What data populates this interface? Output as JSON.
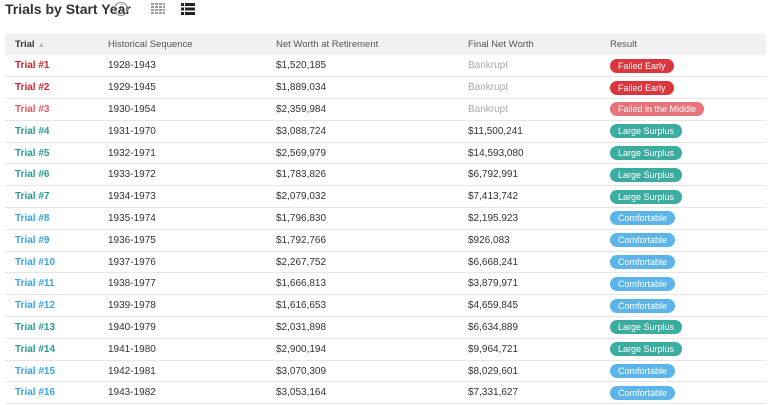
{
  "header": {
    "title": "Trials by Start Year",
    "info_icon_glyph": "i"
  },
  "table": {
    "columns": [
      "Trial",
      "Historical Sequence",
      "Net Worth at Retirement",
      "Final Net Worth",
      "Result"
    ],
    "status_colors": {
      "Failed Early": "#d9363e",
      "Failed in the Middle": "#e8737a",
      "Large Surplus": "#3aada0",
      "Comfortable": "#5bb5ea"
    },
    "trial_colors": {
      "Failed Early": "#c9252c",
      "Failed in the Middle": "#e25b63",
      "Large Surplus": "#2a9d92",
      "Comfortable": "#3aa3e3"
    },
    "rows": [
      {
        "trial": "Trial #1",
        "sequence": "1928-1943",
        "retirement": "$1,520,185",
        "final": "Bankrupt",
        "result": "Failed Early"
      },
      {
        "trial": "Trial #2",
        "sequence": "1929-1945",
        "retirement": "$1,889,034",
        "final": "Bankrupt",
        "result": "Failed Early"
      },
      {
        "trial": "Trial #3",
        "sequence": "1930-1954",
        "retirement": "$2,359,984",
        "final": "Bankrupt",
        "result": "Failed in the Middle"
      },
      {
        "trial": "Trial #4",
        "sequence": "1931-1970",
        "retirement": "$3,088,724",
        "final": "$11,500,241",
        "result": "Large Surplus"
      },
      {
        "trial": "Trial #5",
        "sequence": "1932-1971",
        "retirement": "$2,569,979",
        "final": "$14,593,080",
        "result": "Large Surplus"
      },
      {
        "trial": "Trial #6",
        "sequence": "1933-1972",
        "retirement": "$1,783,826",
        "final": "$6,792,991",
        "result": "Large Surplus"
      },
      {
        "trial": "Trial #7",
        "sequence": "1934-1973",
        "retirement": "$2,079,032",
        "final": "$7,413,742",
        "result": "Large Surplus"
      },
      {
        "trial": "Trial #8",
        "sequence": "1935-1974",
        "retirement": "$1,796,830",
        "final": "$2,195,923",
        "result": "Comfortable"
      },
      {
        "trial": "Trial #9",
        "sequence": "1936-1975",
        "retirement": "$1,792,766",
        "final": "$926,083",
        "result": "Comfortable"
      },
      {
        "trial": "Trial #10",
        "sequence": "1937-1976",
        "retirement": "$2,267,752",
        "final": "$6,668,241",
        "result": "Comfortable"
      },
      {
        "trial": "Trial #11",
        "sequence": "1938-1977",
        "retirement": "$1,666,813",
        "final": "$3,879,971",
        "result": "Comfortable"
      },
      {
        "trial": "Trial #12",
        "sequence": "1939-1978",
        "retirement": "$1,616,653",
        "final": "$4,659,845",
        "result": "Comfortable"
      },
      {
        "trial": "Trial #13",
        "sequence": "1940-1979",
        "retirement": "$2,031,898",
        "final": "$6,634,889",
        "result": "Large Surplus"
      },
      {
        "trial": "Trial #14",
        "sequence": "1941-1980",
        "retirement": "$2,900,194",
        "final": "$9,964,721",
        "result": "Large Surplus"
      },
      {
        "trial": "Trial #15",
        "sequence": "1942-1981",
        "retirement": "$3,070,309",
        "final": "$8,029,601",
        "result": "Comfortable"
      },
      {
        "trial": "Trial #16",
        "sequence": "1943-1982",
        "retirement": "$3,053,164",
        "final": "$7,331,627",
        "result": "Comfortable"
      }
    ]
  }
}
